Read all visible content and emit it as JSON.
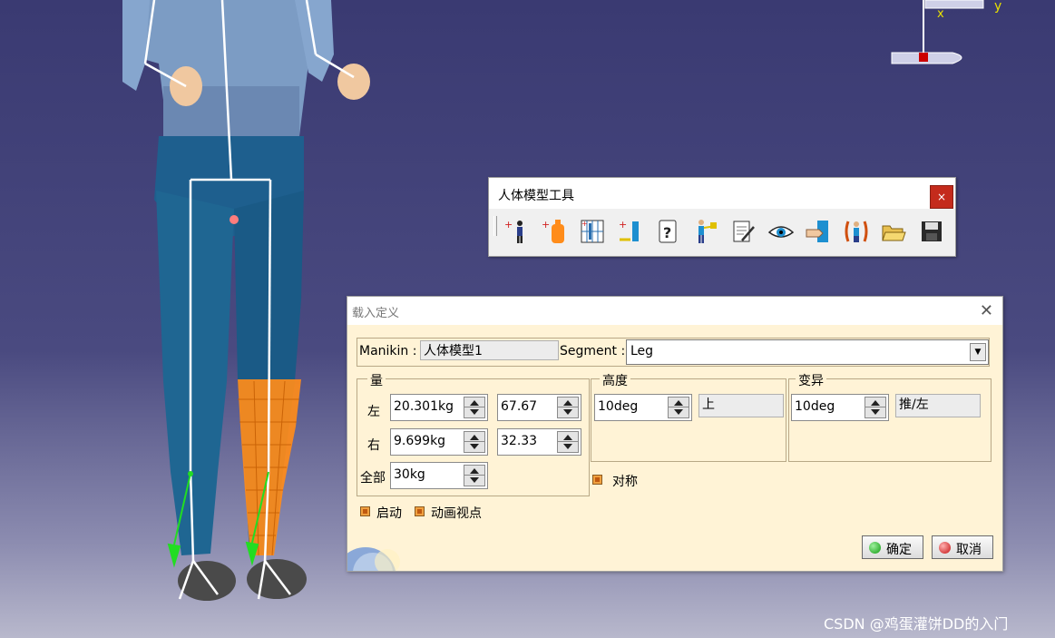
{
  "toolbar": {
    "title": "人体模型工具",
    "close_label": "×",
    "icons": [
      "manikin-insert-icon",
      "bottle-load-icon",
      "grid-chart-icon",
      "insert-segment-icon",
      "help-question-icon",
      "reach-manikin-icon",
      "report-edit-icon",
      "vision-eye-icon",
      "hand-transfer-icon",
      "figure-chain-icon",
      "open-folder-icon",
      "save-disk-icon"
    ]
  },
  "dialog": {
    "title": "载入定义",
    "close_label": "✕",
    "manikin_label": "Manikin :",
    "manikin_value": "人体模型1",
    "segment_label": "Segment :",
    "segment_value": "Leg",
    "load_group": {
      "label": "量",
      "left_label": "左",
      "left_mass": "20.301kg",
      "left_percent": "67.67",
      "right_label": "右",
      "right_mass": "9.699kg",
      "right_percent": "32.33",
      "total_label": "全部",
      "total_mass": "30kg"
    },
    "height_group": {
      "label": "高度",
      "angle": "10deg",
      "direction": "上"
    },
    "variation_group": {
      "label": "变异",
      "angle": "10deg",
      "direction": "推/左"
    },
    "symmetric_label": "对称",
    "start_label": "启动",
    "animate_view_label": "动画视点",
    "ok_label": "确定",
    "cancel_label": "取消"
  },
  "viewport": {
    "axis_x": "x",
    "axis_y": "y"
  },
  "watermark": "CSDN @鸡蛋灌饼DD的入门"
}
